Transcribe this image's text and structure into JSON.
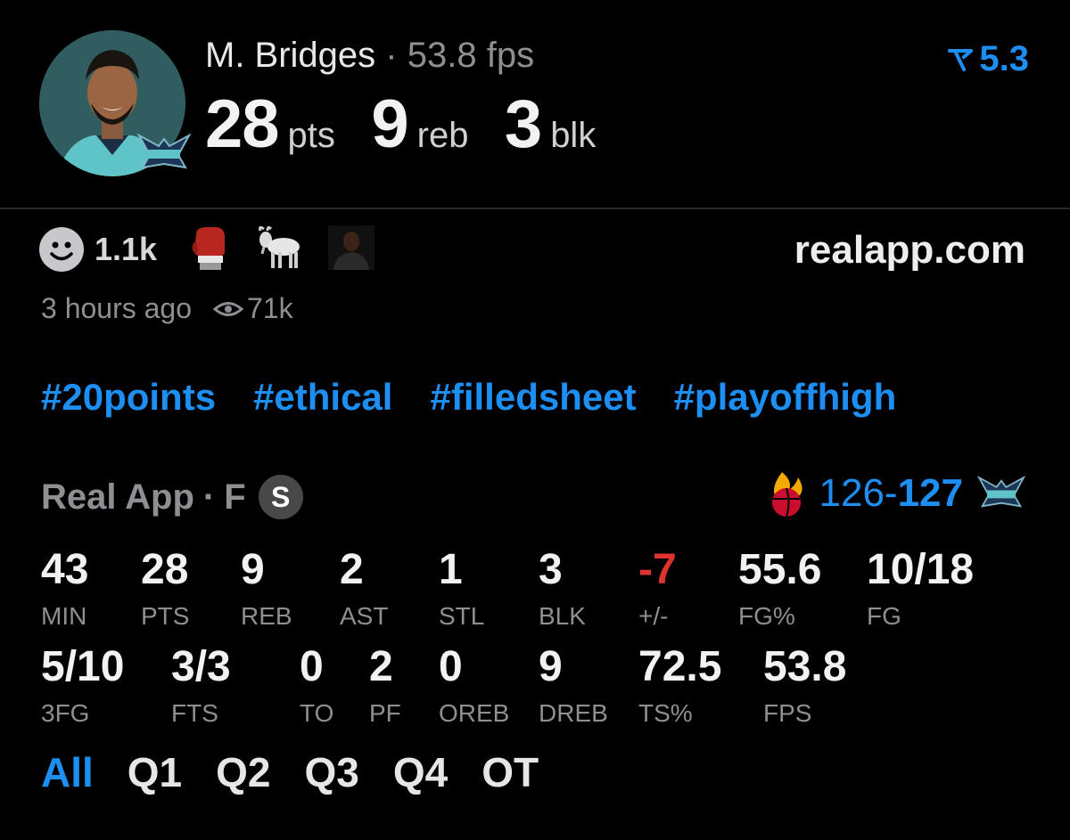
{
  "header": {
    "player_name": "M. Bridges",
    "separator": "·",
    "fps_text": "53.8 fps",
    "stats": [
      {
        "value": "28",
        "unit": "pts"
      },
      {
        "value": "9",
        "unit": "reb"
      },
      {
        "value": "3",
        "unit": "blk"
      }
    ],
    "rating": "5.3"
  },
  "reactions": {
    "count": "1.1k",
    "items": [
      "boxing-glove-icon",
      "goat-icon",
      "player-emoji-icon"
    ]
  },
  "site": "realapp.com",
  "meta": {
    "time_ago": "3 hours ago",
    "views": "71k"
  },
  "tags": [
    "#20points",
    "#ethical",
    "#filledsheet",
    "#playoffhigh"
  ],
  "game": {
    "source": "Real App",
    "status": "F",
    "badge": "S",
    "score_away": "126",
    "score_dash": "-",
    "score_home": "127"
  },
  "box": {
    "row1": [
      {
        "v": "43",
        "l": "MIN"
      },
      {
        "v": "28",
        "l": "PTS"
      },
      {
        "v": "9",
        "l": "REB"
      },
      {
        "v": "2",
        "l": "AST"
      },
      {
        "v": "1",
        "l": "STL"
      },
      {
        "v": "3",
        "l": "BLK"
      },
      {
        "v": "-7",
        "l": "+/-"
      },
      {
        "v": "55.6",
        "l": "FG%"
      },
      {
        "v": "10/18",
        "l": "FG"
      }
    ],
    "row2": [
      {
        "v": "5/10",
        "l": "3FG"
      },
      {
        "v": "3/3",
        "l": "FTS"
      },
      {
        "v": "0",
        "l": "TO"
      },
      {
        "v": "2",
        "l": "PF"
      },
      {
        "v": "0",
        "l": "OREB"
      },
      {
        "v": "9",
        "l": "DREB"
      },
      {
        "v": "72.5",
        "l": "TS%"
      },
      {
        "v": "53.8",
        "l": "FPS"
      }
    ]
  },
  "tabs": [
    "All",
    "Q1",
    "Q2",
    "Q3",
    "Q4",
    "OT"
  ],
  "colors": {
    "accent": "#1d8ff2",
    "negative": "#e0332f",
    "muted": "#8e8e93"
  }
}
